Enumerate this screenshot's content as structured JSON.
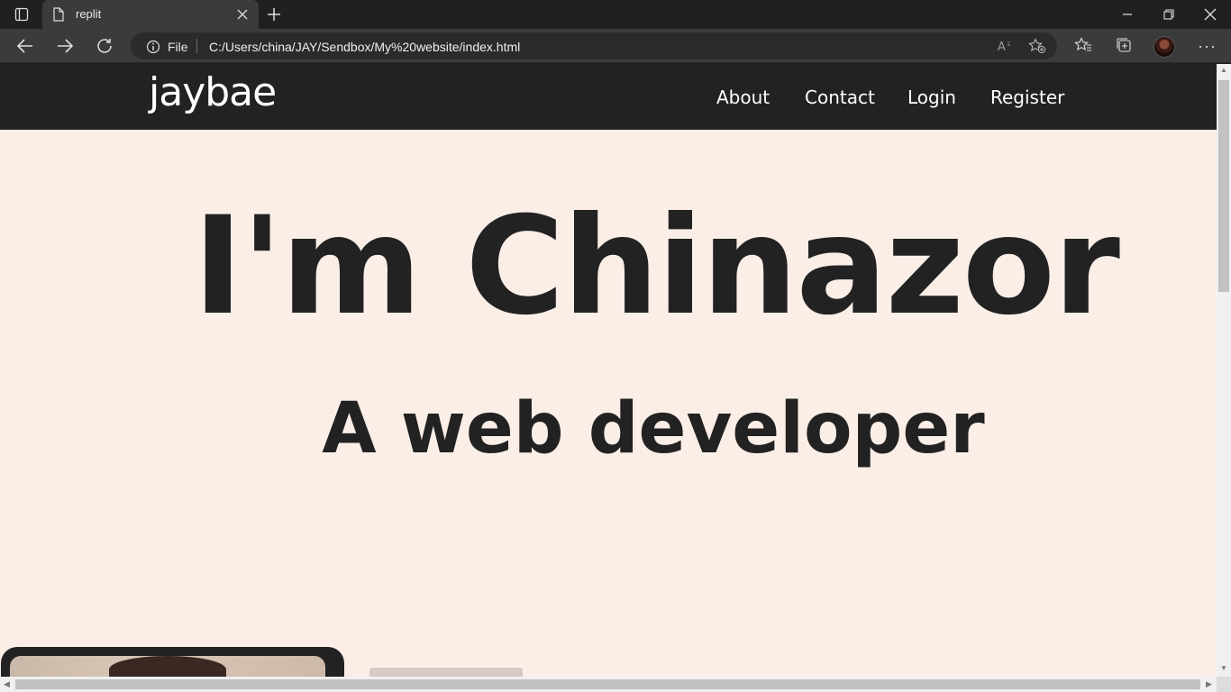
{
  "browser": {
    "tab_title": "replit",
    "address_scheme_label": "File",
    "address_url": "C:/Users/china/JAY/Sendbox/My%20website/index.html",
    "theme_colors": {
      "chrome": "#202020",
      "toolbar": "#3b3b3b",
      "urlbar": "#2b2b2b"
    },
    "toolbar_icons": [
      "back-icon",
      "forward-icon",
      "refresh-icon",
      "info-icon",
      "read-aloud-icon",
      "add-favorite-icon",
      "favorites-icon",
      "collections-icon",
      "profile-avatar",
      "more-icon"
    ]
  },
  "site": {
    "logo": "jaybae",
    "nav": [
      "About",
      "Contact",
      "Login",
      "Register"
    ],
    "hero_title": "I'm Chinazor",
    "hero_subtitle": "A web developer",
    "colors": {
      "nav_bg": "#222222",
      "page_bg": "#fbeee7",
      "text": "#222222"
    }
  }
}
